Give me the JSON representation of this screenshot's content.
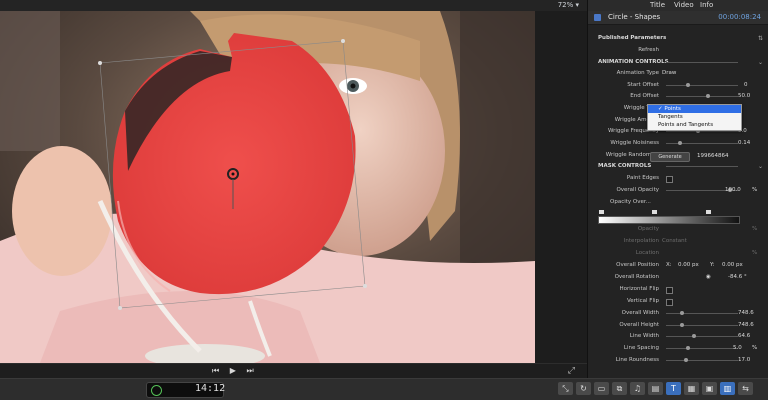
{
  "viewer": {
    "zoom": "72% ▾",
    "transport": {
      "prev": "⏮",
      "play": "▶",
      "next": "⏭"
    },
    "fullscreen_icon": "fullscreen-icon"
  },
  "toolbar": {
    "timecode": "14:12",
    "icons": [
      "⤡",
      "↻",
      "▭",
      "⧉",
      "♫",
      "▤",
      "T",
      "▦",
      "▣",
      "▥",
      "⇆"
    ]
  },
  "inspector": {
    "tabs": {
      "title": "Title",
      "video": "Video",
      "info": "Info"
    },
    "header_title": "Circle - Shapes",
    "header_timecode": "00:00:08:24",
    "published_parameters": "Published Parameters",
    "refresh": "Refresh",
    "animation_controls": "ANIMATION CONTROLS",
    "animation_type_label": "Animation Type",
    "animation_type_value": "Draw",
    "start_offset_label": "Start Offset",
    "start_offset_value": "0",
    "end_offset_label": "End Offset",
    "end_offset_value": "50.0",
    "wriggle_type_label": "Wriggle Type",
    "wriggle_amount_label": "Wriggle Amount",
    "wriggle_frequency_label": "Wriggle Frequency",
    "wriggle_frequency_value": "2.0",
    "wriggle_noisiness_label": "Wriggle Noisiness",
    "wriggle_noisiness_value": "0.14",
    "wriggle_randomize_label": "Wriggle Randomize",
    "generate_label": "Generate",
    "randomize_value": "199664864",
    "mask_controls": "MASK CONTROLS",
    "feather_edges_label": "Paint Edges",
    "overall_opacity_label": "Overall Opacity",
    "overall_opacity_value": "100.0",
    "percent": "%",
    "opacity_over_label": "Opacity Over...",
    "opacity_label": "Opacity",
    "interpolation_label": "Interpolation",
    "interpolation_value": "Constant",
    "location_label": "Location",
    "overall_position_label": "Overall Position",
    "pos_x_label": "X:",
    "pos_x_value": "0.00 px",
    "pos_y_label": "Y:",
    "pos_y_value": "0.00 px",
    "overall_rotation_label": "Overall Rotation",
    "overall_rotation_value": "-84.6 °",
    "horizontal_flip_label": "Horizontal Flip",
    "vertical_flip_label": "Vertical Flip",
    "overall_width_label": "Overall Width",
    "overall_width_value": "748.6",
    "overall_height_label": "Overall Height",
    "overall_height_value": "748.6",
    "line_width_label": "Line Width",
    "line_width_value": "64.6",
    "line_spacing_label": "Line Spacing",
    "line_spacing_value": "5.0",
    "line_roundness_label": "Line Roundness",
    "line_roundness_value": "17.0"
  },
  "dropdown": {
    "options": [
      "✓ Points",
      "Tangents",
      "Points and Tangents"
    ]
  },
  "colors": {
    "accent": "#2f6ee5",
    "shape_red": "#e8413f"
  }
}
